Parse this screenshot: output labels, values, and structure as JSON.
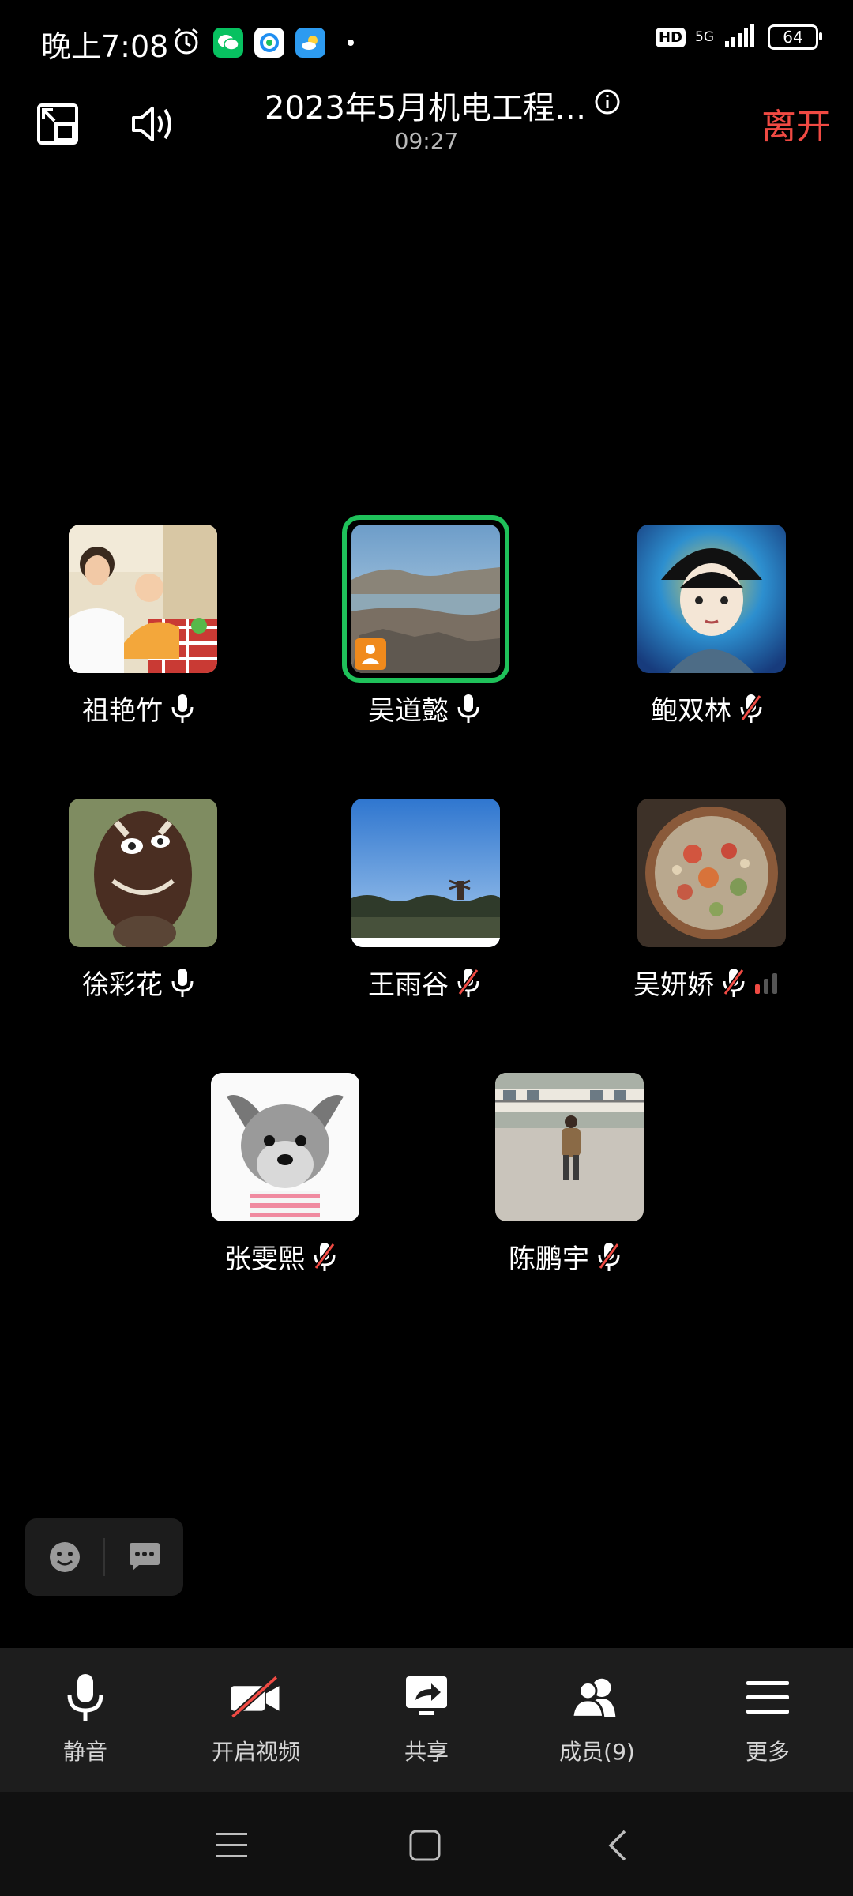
{
  "status_bar": {
    "time": "晚上7:08",
    "hd": "HD",
    "network": "5G",
    "battery": "64"
  },
  "header": {
    "meeting_title": "2023年5月机电工程…",
    "timer": "09:27",
    "leave_label": "离开"
  },
  "participants": [
    {
      "name": "祖艳竹",
      "mic": "on"
    },
    {
      "name": "吴道懿",
      "mic": "on",
      "speaking": true,
      "host": true
    },
    {
      "name": "鲍双林",
      "mic": "muted"
    },
    {
      "name": "徐彩花",
      "mic": "on"
    },
    {
      "name": "王雨谷",
      "mic": "muted"
    },
    {
      "name": "吴妍娇",
      "mic": "muted",
      "weak_signal": true
    },
    {
      "name": "张雯熙",
      "mic": "muted"
    },
    {
      "name": "陈鹏宇",
      "mic": "muted"
    }
  ],
  "toolbar": {
    "mute_label": "静音",
    "video_label": "开启视频",
    "share_label": "共享",
    "members_label": "成员(9)",
    "more_label": "更多"
  },
  "colors": {
    "leave": "#f04a43",
    "speaking_ring": "#1fc15a",
    "host_badge": "#f08a1c"
  }
}
